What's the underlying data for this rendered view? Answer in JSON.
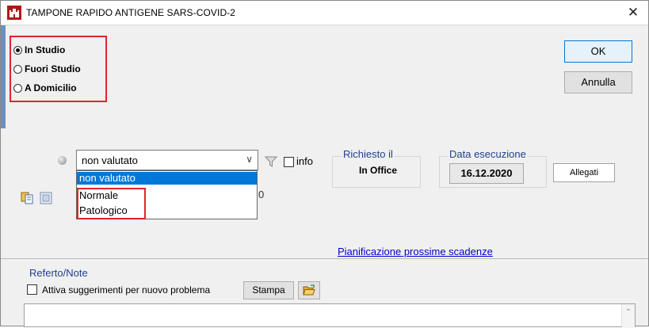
{
  "window": {
    "title": "TAMPONE RAPIDO ANTIGENE SARS-COVID-2",
    "close_glyph": "✕",
    "icon": "app-castle-icon"
  },
  "location": {
    "options": [
      {
        "label": "In Studio",
        "selected": true
      },
      {
        "label": "Fuori Studio",
        "selected": false
      },
      {
        "label": "A Domicilio",
        "selected": false
      }
    ]
  },
  "buttons": {
    "ok": "OK",
    "annulla": "Annulla",
    "allegati": "Allegati",
    "stampa": "Stampa"
  },
  "result": {
    "selected": "non valutato",
    "options": [
      "non valutato",
      "Normale",
      "Patologico"
    ],
    "partial_digit": "0"
  },
  "info": {
    "label": "info",
    "checked": false
  },
  "richiesto": {
    "title": "Richiesto il",
    "value": "In Office"
  },
  "data_esecuzione": {
    "title": "Data esecuzione",
    "value": "16.12.2020"
  },
  "link": {
    "label": "Pianificazione prossime scadenze"
  },
  "referto": {
    "title": "Referto/Note",
    "attiva_label": "Attiva suggerimenti per nuovo problema",
    "attiva_checked": false,
    "text": ""
  },
  "colors": {
    "highlight": "#e0242c",
    "selection": "#0078d7",
    "group_title": "#1f3f8f",
    "link": "#0000cc"
  }
}
